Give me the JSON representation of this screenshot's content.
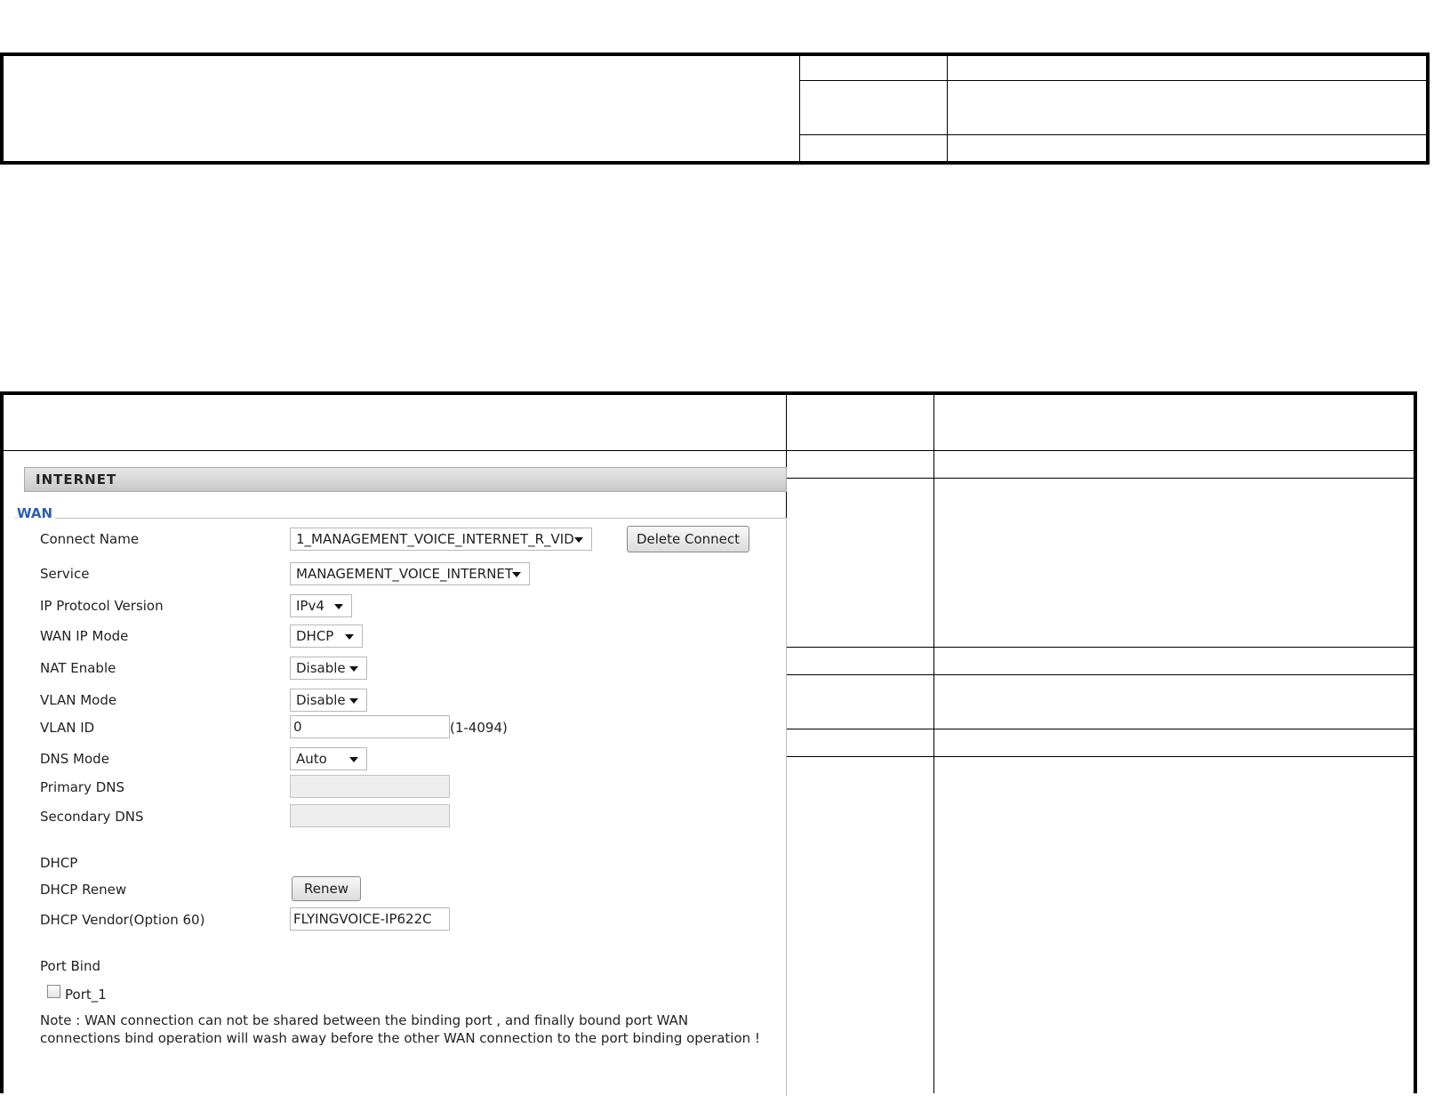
{
  "internet_panel": {
    "title": "INTERNET",
    "section_legend": "WAN",
    "fields": {
      "connect_name": {
        "label": "Connect Name",
        "value": "1_MANAGEMENT_VOICE_INTERNET_R_VID"
      },
      "delete_connect_button": "Delete Connect",
      "service": {
        "label": "Service",
        "value": "MANAGEMENT_VOICE_INTERNET"
      },
      "ip_protocol_version": {
        "label": "IP Protocol Version",
        "value": "IPv4"
      },
      "wan_ip_mode": {
        "label": "WAN IP Mode",
        "value": "DHCP"
      },
      "nat_enable": {
        "label": "NAT Enable",
        "value": "Disable"
      },
      "vlan_mode": {
        "label": "VLAN Mode",
        "value": "Disable"
      },
      "vlan_id": {
        "label": "VLAN ID",
        "value": "0",
        "range_hint": "(1-4094)"
      },
      "dns_mode": {
        "label": "DNS Mode",
        "value": "Auto"
      },
      "primary_dns": {
        "label": "Primary DNS",
        "value": ""
      },
      "secondary_dns": {
        "label": "Secondary DNS",
        "value": ""
      }
    },
    "dhcp": {
      "heading": "DHCP",
      "renew_label": "DHCP Renew",
      "renew_button": "Renew",
      "vendor_label": "DHCP Vendor(Option 60)",
      "vendor_value": "FLYINGVOICE-IP622C"
    },
    "port_bind": {
      "heading": "Port Bind",
      "ports": [
        {
          "label": "Port_1",
          "checked": false
        }
      ]
    },
    "note": "Note : WAN connection can not be shared between the binding port , and finally bound port WAN connections bind operation will wash away before the other WAN connection to the port binding operation !"
  }
}
